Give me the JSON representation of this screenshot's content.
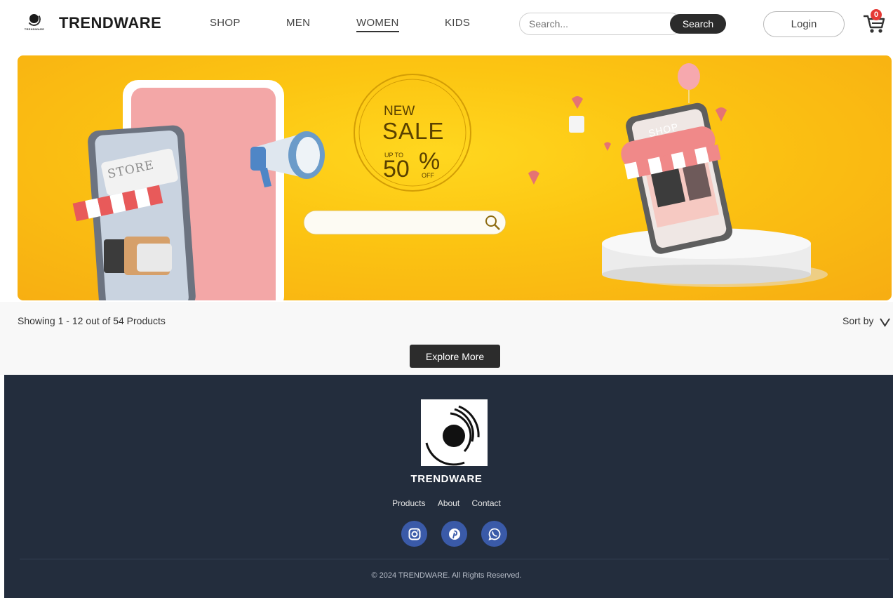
{
  "header": {
    "brand": "TRENDWARE",
    "brand_small": "TRENDWARE",
    "nav": [
      "SHOP",
      "MEN",
      "WOMEN",
      "KIDS"
    ],
    "active_nav": "WOMEN",
    "search_placeholder": "Search...",
    "search_button": "Search",
    "login_button": "Login",
    "cart_count": "0"
  },
  "hero": {
    "badge_new": "NEW",
    "badge_sale": "SALE",
    "badge_upto": "UP TO",
    "badge_value": "50",
    "badge_percent": "%",
    "badge_off": "OFF",
    "store_sign": "STORE",
    "shop_sign": "SHOP"
  },
  "products": {
    "showing": "Showing 1 - 12 out of 54 Products",
    "sort_label": "Sort by",
    "explore_button": "Explore More"
  },
  "footer": {
    "brand": "TRENDWARE",
    "links": [
      "Products",
      "About",
      "Contact"
    ],
    "social": [
      "instagram-icon",
      "pinterest-icon",
      "whatsapp-icon"
    ],
    "copyright": "© 2024 TRENDWARE. All Rights Reserved."
  },
  "colors": {
    "hero_yellow": "#fcc512",
    "footer_bg": "#232d3d",
    "social_bg": "#3a5aa8",
    "badge_red": "#e53935"
  }
}
